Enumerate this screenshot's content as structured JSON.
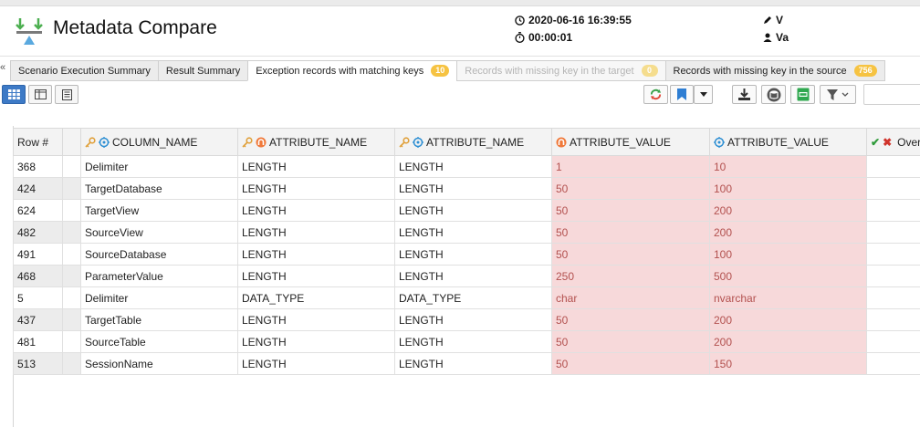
{
  "app": {
    "title": "Metadata Compare"
  },
  "run": {
    "datetime": "2020-06-16 16:39:55",
    "duration": "00:00:01"
  },
  "user": {
    "line1": "V",
    "line2": "Va"
  },
  "colors": {
    "badge": "#f6c342",
    "diff_bg": "#f7d9da",
    "diff_text": "#b3514f",
    "active_view": "#3d7ac6",
    "target_icon": "#2e8fd3",
    "source_icon": "#f0793a"
  },
  "tabs": [
    {
      "label": "Scenario Execution Summary",
      "badge": ""
    },
    {
      "label": "Result Summary",
      "badge": ""
    },
    {
      "label": "Exception records with matching keys",
      "badge": "10"
    },
    {
      "label": "Records with missing key in the target",
      "badge": "0"
    },
    {
      "label": "Records with missing key in the source",
      "badge": "756"
    }
  ],
  "columns": {
    "row": "Row #",
    "column_name": "COLUMN_NAME",
    "attr_name_source": "ATTRIBUTE_NAME",
    "attr_name_target": "ATTRIBUTE_NAME",
    "attr_value_source": "ATTRIBUTE_VALUE",
    "attr_value_target": "ATTRIBUTE_VALUE",
    "overall": "Overa"
  },
  "rows": [
    {
      "row": "368",
      "column_name": "Delimiter",
      "attr_name_source": "LENGTH",
      "attr_name_target": "LENGTH",
      "value_source": "1",
      "value_target": "10"
    },
    {
      "row": "424",
      "column_name": "TargetDatabase",
      "attr_name_source": "LENGTH",
      "attr_name_target": "LENGTH",
      "value_source": "50",
      "value_target": "100"
    },
    {
      "row": "624",
      "column_name": "TargetView",
      "attr_name_source": "LENGTH",
      "attr_name_target": "LENGTH",
      "value_source": "50",
      "value_target": "200"
    },
    {
      "row": "482",
      "column_name": "SourceView",
      "attr_name_source": "LENGTH",
      "attr_name_target": "LENGTH",
      "value_source": "50",
      "value_target": "200"
    },
    {
      "row": "491",
      "column_name": "SourceDatabase",
      "attr_name_source": "LENGTH",
      "attr_name_target": "LENGTH",
      "value_source": "50",
      "value_target": "100"
    },
    {
      "row": "468",
      "column_name": "ParameterValue",
      "attr_name_source": "LENGTH",
      "attr_name_target": "LENGTH",
      "value_source": "250",
      "value_target": "500"
    },
    {
      "row": "5",
      "column_name": "Delimiter",
      "attr_name_source": "DATA_TYPE",
      "attr_name_target": "DATA_TYPE",
      "value_source": "char",
      "value_target": "nvarchar"
    },
    {
      "row": "437",
      "column_name": "TargetTable",
      "attr_name_source": "LENGTH",
      "attr_name_target": "LENGTH",
      "value_source": "50",
      "value_target": "200"
    },
    {
      "row": "481",
      "column_name": "SourceTable",
      "attr_name_source": "LENGTH",
      "attr_name_target": "LENGTH",
      "value_source": "50",
      "value_target": "200"
    },
    {
      "row": "513",
      "column_name": "SessionName",
      "attr_name_source": "LENGTH",
      "attr_name_target": "LENGTH",
      "value_source": "50",
      "value_target": "150"
    }
  ]
}
